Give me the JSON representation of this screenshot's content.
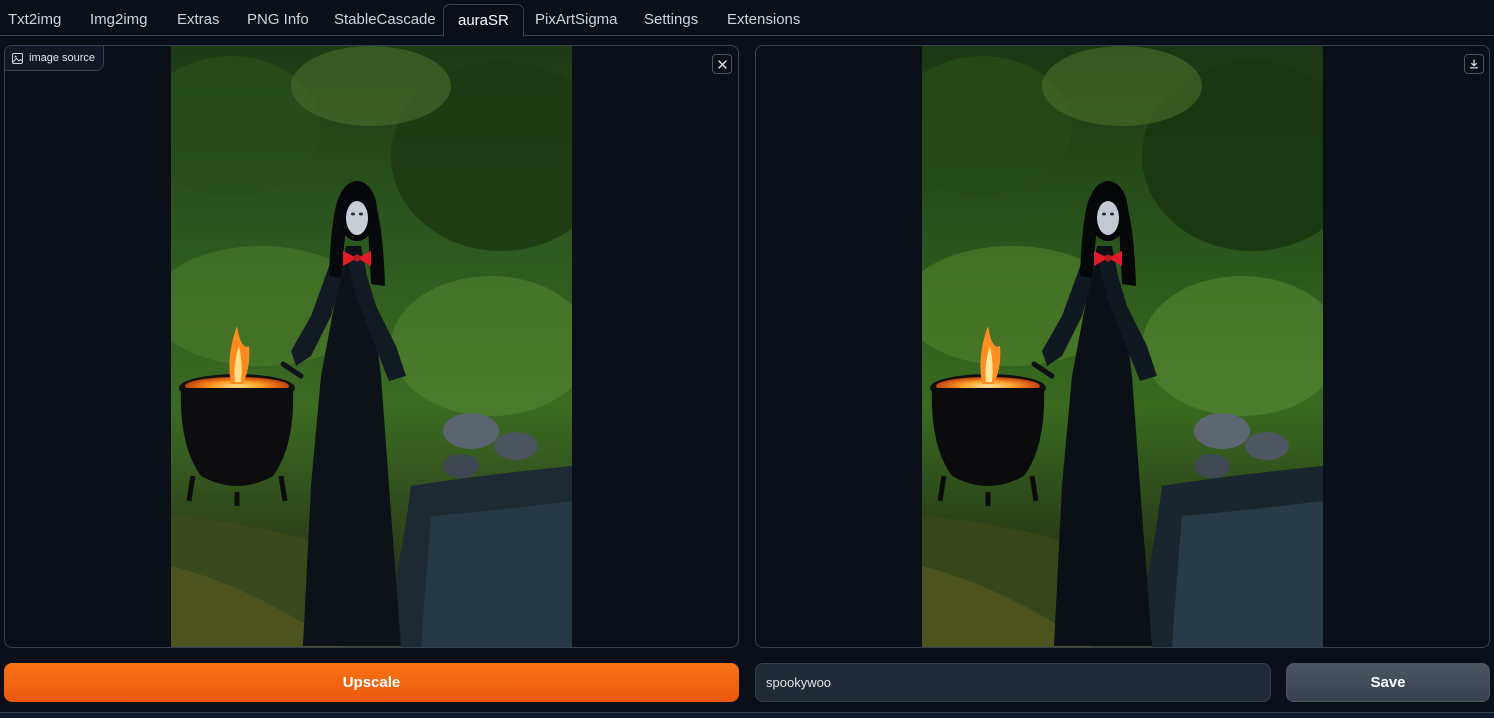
{
  "tabs": [
    {
      "label": "Txt2img",
      "active": false
    },
    {
      "label": "Img2img",
      "active": false
    },
    {
      "label": "Extras",
      "active": false
    },
    {
      "label": "PNG Info",
      "active": false
    },
    {
      "label": "StableCascade",
      "active": false
    },
    {
      "label": "auraSR",
      "active": true
    },
    {
      "label": "PixArtSigma",
      "active": false
    },
    {
      "label": "Settings",
      "active": false
    },
    {
      "label": "Extensions",
      "active": false
    }
  ],
  "source_panel": {
    "label": "image source",
    "label_icon": "image-icon",
    "clear_icon": "close-icon"
  },
  "output_panel": {
    "download_icon": "download-icon"
  },
  "actions": {
    "upscale_label": "Upscale",
    "filename_value": "spookywoo",
    "save_label": "Save"
  },
  "colors": {
    "background": "#0b0f19",
    "accent": "#f97316",
    "border": "#374151"
  }
}
